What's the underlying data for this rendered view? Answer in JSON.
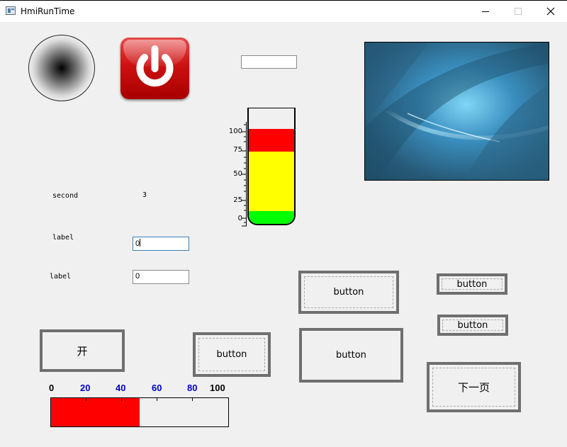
{
  "window": {
    "title": "HmiRunTime",
    "controls": [
      "minimize",
      "maximize",
      "close"
    ]
  },
  "labels": {
    "second_label": "second",
    "second_value": "3",
    "label_1": "label",
    "label_2": "label"
  },
  "fields": {
    "field_1_value": "0",
    "field_2_value": "0",
    "top_textbox_value": ""
  },
  "tube_gauge": {
    "ticks": [
      "100",
      "75",
      "50",
      "25",
      "0"
    ],
    "value": 100,
    "colors": {
      "high": "#ff0000",
      "mid": "#ffff00",
      "low": "#00ff00"
    }
  },
  "buttons": {
    "kai": "开",
    "button_a": "button",
    "button_b": "button",
    "button_c": "button",
    "button_d": "button",
    "button_e": "button",
    "next_page": "下一页"
  },
  "scale_bar": {
    "ticks": [
      "0",
      "20",
      "40",
      "60",
      "80",
      "100"
    ],
    "tick_colors": [
      "#000000",
      "#0000cc",
      "#0000cc",
      "#0000cc",
      "#0000cc",
      "#000000"
    ],
    "value": 50,
    "fill_color": "#ff0000"
  },
  "icons": {
    "knob": "radial-knob-icon",
    "power": "power-icon",
    "image": "abstract-blue-wallpaper"
  }
}
